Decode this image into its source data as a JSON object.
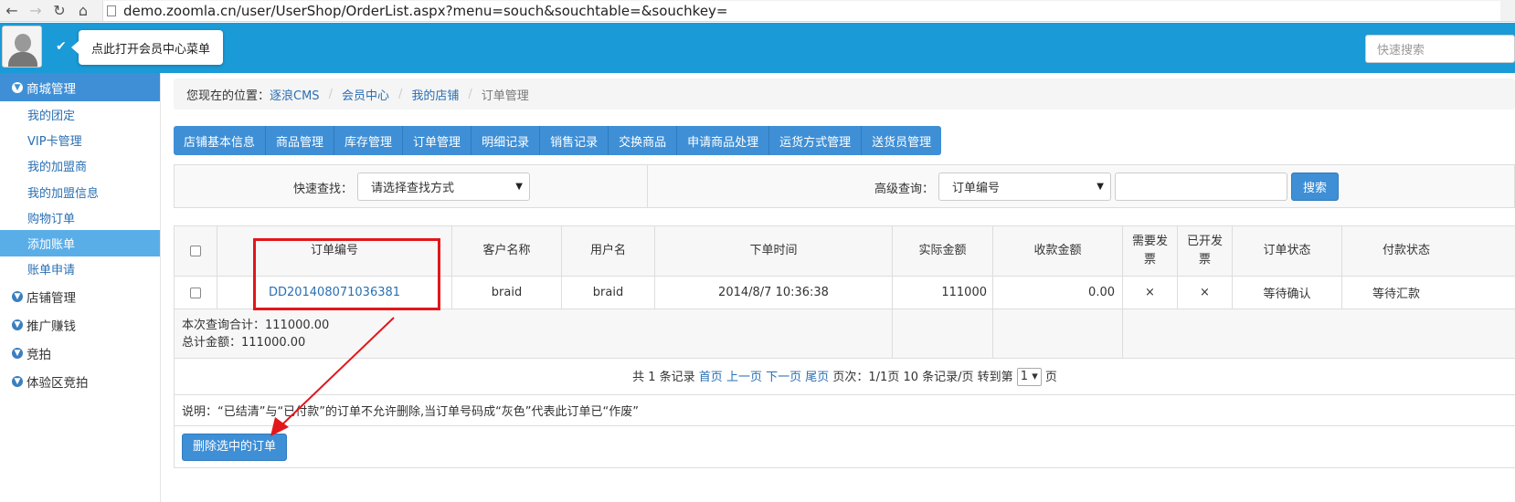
{
  "browser": {
    "url": "demo.zoomla.cn/user/UserShop/OrderList.aspx?menu=souch&souchtable=&souchkey="
  },
  "topbar": {
    "tooltip": "点此打开会员中心菜单",
    "quick_search_placeholder": "快速搜索",
    "color": "#1a9ad6"
  },
  "sidebar": {
    "sections": [
      {
        "label": "商城管理",
        "active": true,
        "items": [
          "我的团定",
          "VIP卡管理",
          "我的加盟商",
          "我的加盟信息",
          "购物订单",
          "添加账单",
          "账单申请"
        ],
        "active_item": "添加账单"
      },
      {
        "label": "店铺管理"
      },
      {
        "label": "推广赚钱"
      },
      {
        "label": "竞拍"
      },
      {
        "label": "体验区竞拍"
      }
    ]
  },
  "breadcrumb": {
    "prefix": "您现在的位置：",
    "items": [
      "逐浪CMS",
      "会员中心",
      "我的店铺"
    ],
    "current": "订单管理"
  },
  "tabs": [
    "店铺基本信息",
    "商品管理",
    "库存管理",
    "订单管理",
    "明细记录",
    "销售记录",
    "交换商品",
    "申请商品处理",
    "运货方式管理",
    "送货员管理"
  ],
  "search": {
    "quick_label": "快速查找：",
    "quick_select": "请选择查找方式",
    "advanced_label": "高级查询：",
    "advanced_select": "订单编号",
    "button": "搜索"
  },
  "table": {
    "headers": [
      "订单编号",
      "客户名称",
      "用户名",
      "下单时间",
      "实际金额",
      "收款金额",
      "需要发票",
      "已开发票",
      "订单状态",
      "付款状态"
    ],
    "rows": [
      {
        "order_no": "DD201408071036381",
        "customer": "braid",
        "username": "braid",
        "time": "2014/8/7 10:36:38",
        "actual": "111000",
        "received": "0.00",
        "need_invoice": "×",
        "invoiced": "×",
        "order_status": "等待确认",
        "pay_status": "等待汇款"
      }
    ],
    "summary_query": "本次查询合计：111000.00",
    "summary_total": "总计金额：111000.00"
  },
  "pager": {
    "total_prefix": "共 1 条记录",
    "first": "首页",
    "prev": "上一页",
    "next": "下一页",
    "last": "尾页",
    "page_info": "页次：1/1页 10 条记录/页 转到第",
    "page_value": "1",
    "page_suffix": "页"
  },
  "note": "说明：“已结清”与“已付款”的订单不允许删除,当订单号码成“灰色”代表此订单已“作废”",
  "delete_button": "删除选中的订单",
  "colors": {
    "accent": "#3e8fd6",
    "link": "#2a6fb3",
    "annotation": "#e3161b"
  }
}
